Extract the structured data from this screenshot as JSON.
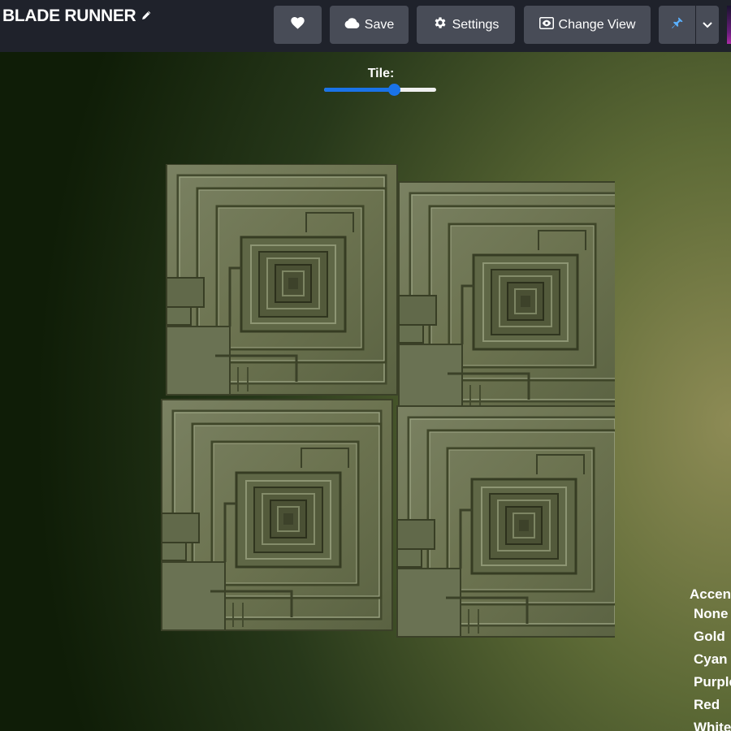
{
  "header": {
    "title": "BLADE RUNNER",
    "edit_icon": "pencil-icon",
    "buttons": {
      "favorite": {
        "icon": "heart-icon"
      },
      "save": {
        "label": "Save",
        "icon": "cloud-icon"
      },
      "settings": {
        "label": "Settings",
        "icon": "gear-icon"
      },
      "change_view": {
        "label": "Change View",
        "icon": "eye-icon"
      },
      "pin": {
        "icon": "pin-icon",
        "color": "#5ab0ff"
      },
      "dropdown": {
        "icon": "chevron-down-icon"
      }
    }
  },
  "tile_control": {
    "label": "Tile:",
    "value": 0.62,
    "accent": "#1a73e8"
  },
  "preview": {
    "image": "tile-texture-image",
    "tile_color": "#6e7652",
    "grid": [
      2,
      2
    ]
  },
  "accent_menu": {
    "title": "Accent",
    "options": [
      "None",
      "Gold",
      "Cyan",
      "Purple",
      "Red",
      "White"
    ]
  },
  "colors": {
    "header_bg": "#1f222b",
    "button_bg": "#484c57",
    "scene_light": "#8d8b55",
    "scene_dark": "#0f1d07"
  }
}
